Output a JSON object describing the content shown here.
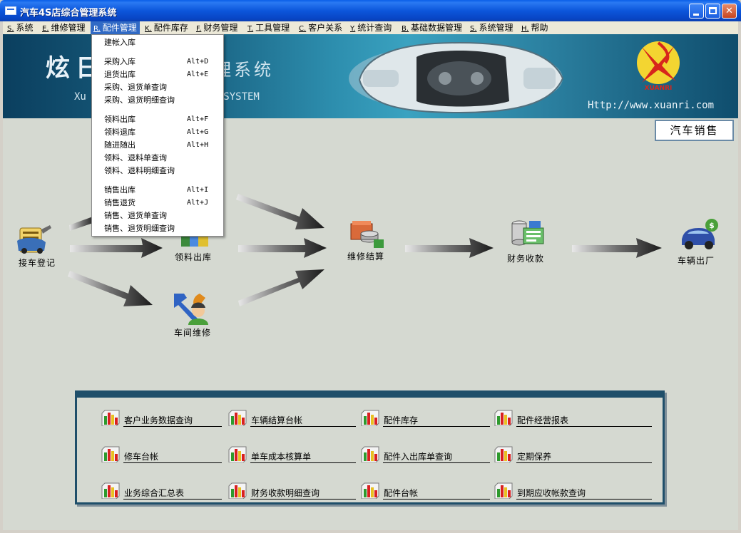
{
  "window": {
    "title": "汽车4S店综合管理系统"
  },
  "menubar": [
    {
      "key": "S.",
      "label": "系统"
    },
    {
      "key": "E.",
      "label": "维修管理"
    },
    {
      "key": "R.",
      "label": "配件管理"
    },
    {
      "key": "K.",
      "label": "配件库存"
    },
    {
      "key": "F.",
      "label": "财务管理"
    },
    {
      "key": "T.",
      "label": "工具管理"
    },
    {
      "key": "C.",
      "label": "客户关系"
    },
    {
      "key": "Y.",
      "label": "统计查询"
    },
    {
      "key": "B.",
      "label": "基础数据管理"
    },
    {
      "key": "S.",
      "label": "系统管理"
    },
    {
      "key": "H.",
      "label": "帮助"
    }
  ],
  "dropdown": {
    "items": [
      {
        "label": "建帐入库",
        "shortcut": ""
      },
      {
        "label": "采购入库",
        "shortcut": "Alt+D"
      },
      {
        "label": "退货出库",
        "shortcut": "Alt+E"
      },
      {
        "label": "采购、退货单查询",
        "shortcut": ""
      },
      {
        "label": "采购、退货明细查询",
        "shortcut": ""
      },
      {
        "label": "领料出库",
        "shortcut": "Alt+F"
      },
      {
        "label": "领料退库",
        "shortcut": "Alt+G"
      },
      {
        "label": "随进随出",
        "shortcut": "Alt+H"
      },
      {
        "label": "领料、退料单查询",
        "shortcut": ""
      },
      {
        "label": "领料、退料明细查询",
        "shortcut": ""
      },
      {
        "label": "销售出库",
        "shortcut": "Alt+I"
      },
      {
        "label": "销售退货",
        "shortcut": "Alt+J"
      },
      {
        "label": "销售、退货单查询",
        "shortcut": ""
      },
      {
        "label": "销售、退货明细查询",
        "shortcut": ""
      }
    ]
  },
  "banner": {
    "title_a": "炫日",
    "title_b": "理系统",
    "sub_a": "Xu",
    "sub_b": "nt SYSTEM",
    "url": "Http://www.xuanri.com",
    "logo_text": "XUANRI"
  },
  "car_sales_button": "汽车销售",
  "flow": {
    "reception": "接车登记",
    "parts_out": "领料出库",
    "workshop": "车间维修",
    "settlement": "维修结算",
    "finance": "财务收款",
    "exit": "车辆出厂"
  },
  "reports": [
    "客户业务数据查询",
    "车辆结算台帐",
    "配件库存",
    "配件经营报表",
    "修车台帐",
    "单车成本核算单",
    "配件入出库单查询",
    "定期保养",
    "业务综合汇总表",
    "财务收款明细查询",
    "配件台帐",
    "到期应收帐款查询"
  ],
  "colors": {
    "title_bar": "#0c56db",
    "menu_highlight": "#316ac5",
    "banner": "#1d6a8a",
    "client_bg": "#d5d9d1",
    "panel_border": "#1f4f6a"
  }
}
